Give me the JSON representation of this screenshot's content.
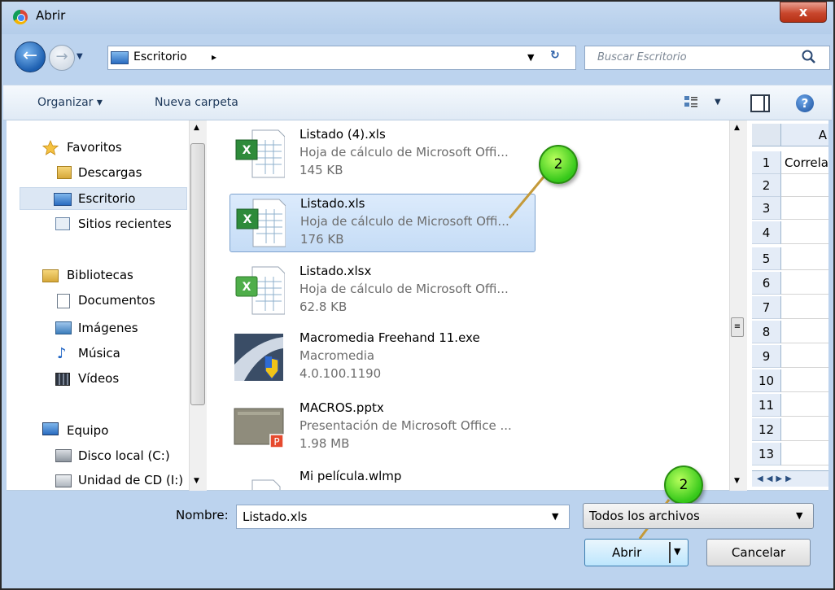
{
  "window": {
    "title": "Abrir",
    "close_glyph": "x"
  },
  "nav": {
    "address_segment": "Escritorio",
    "address_arrow": "▸",
    "search_placeholder": "Buscar Escritorio"
  },
  "toolbar": {
    "organize_label": "Organizar ▾",
    "new_folder_label": "Nueva carpeta",
    "help_glyph": "?"
  },
  "sidebar": {
    "groups": [
      {
        "label": "Favoritos",
        "icon": "star-icon",
        "items": [
          {
            "label": "Descargas",
            "icon": "downloads-folder-icon"
          },
          {
            "label": "Escritorio",
            "icon": "desktop-icon",
            "selected": true
          },
          {
            "label": "Sitios recientes",
            "icon": "recent-places-icon"
          }
        ]
      },
      {
        "label": "Bibliotecas",
        "icon": "libraries-icon",
        "items": [
          {
            "label": "Documentos",
            "icon": "documents-icon"
          },
          {
            "label": "Imágenes",
            "icon": "pictures-icon"
          },
          {
            "label": "Música",
            "icon": "music-icon"
          },
          {
            "label": "Vídeos",
            "icon": "videos-icon"
          }
        ]
      },
      {
        "label": "Equipo",
        "icon": "computer-icon",
        "items": [
          {
            "label": "Disco local (C:)",
            "icon": "local-disk-icon"
          },
          {
            "label": "Unidad de CD (I:)",
            "icon": "cd-drive-icon"
          }
        ]
      }
    ]
  },
  "files": [
    {
      "name": "Listado (4).xls",
      "type": "Hoja de cálculo de Microsoft Offi...",
      "size": "145 KB",
      "icon": "excel-file-icon"
    },
    {
      "name": "Listado.xls",
      "type": "Hoja de cálculo de Microsoft Offi...",
      "size": "176 KB",
      "icon": "excel-file-icon",
      "selected": true
    },
    {
      "name": "Listado.xlsx",
      "type": "Hoja de cálculo de Microsoft Offi...",
      "size": "62.8 KB",
      "icon": "excel-xlsx-file-icon"
    },
    {
      "name": "Macromedia Freehand 11.exe",
      "type": "Macromedia",
      "size": "4.0.100.1190",
      "icon": "freehand-exe-icon"
    },
    {
      "name": "MACROS.pptx",
      "type": "Presentación de Microsoft Office ...",
      "size": "1.98 MB",
      "icon": "powerpoint-file-icon"
    },
    {
      "name": "Mi película.wlmp",
      "type": "",
      "size": "",
      "icon": "movie-project-icon"
    }
  ],
  "preview": {
    "column_header": "A",
    "rows": [
      "1",
      "2",
      "3",
      "4",
      "5",
      "6",
      "7",
      "8",
      "9",
      "10",
      "11",
      "12",
      "13"
    ],
    "first_cell": "Correla"
  },
  "callouts": {
    "upper": "2",
    "lower": "2"
  },
  "bottom": {
    "filename_label": "Nombre:",
    "filename_value": "Listado.xls",
    "filter_value": "Todos los archivos",
    "open_label": "Abrir",
    "cancel_label": "Cancelar"
  },
  "colors": {
    "selection": "#c5dcf6",
    "callout": "#35c81a",
    "close": "#c9472d"
  }
}
